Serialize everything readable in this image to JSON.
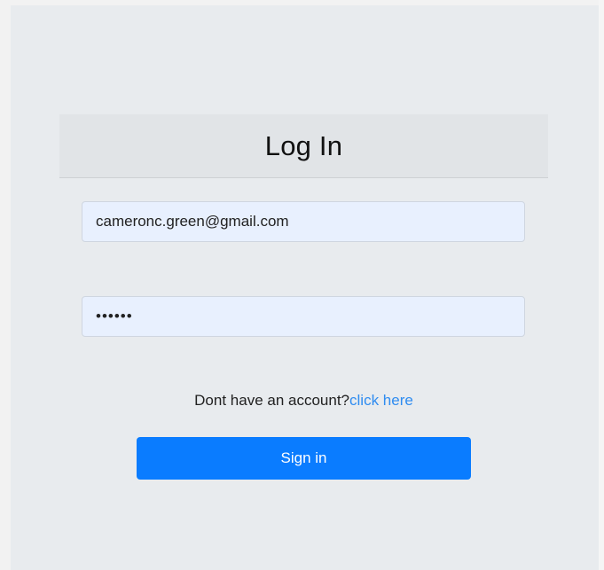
{
  "login": {
    "title": "Log In",
    "email_value": "cameronc.green@gmail.com",
    "password_value": "••••••",
    "signup_prompt": "Dont have an account?",
    "signup_link": "click here",
    "submit_label": "Sign in"
  },
  "colors": {
    "page_background": "#e8ebee",
    "header_background": "#e1e4e7",
    "field_background": "#e8f0fe",
    "link": "#2f8cf0",
    "primary_button": "#0a7cff"
  }
}
